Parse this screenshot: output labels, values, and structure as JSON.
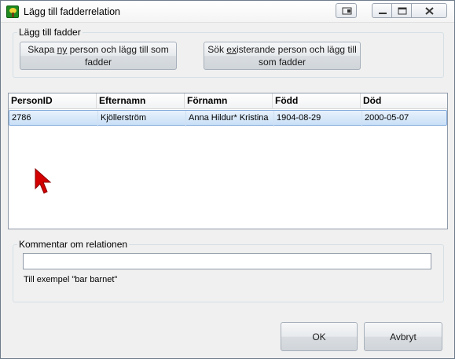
{
  "window": {
    "title": "Lägg till fadderrelation"
  },
  "add_group": {
    "legend": "Lägg till fadder",
    "new_button": {
      "pre": "Skapa ",
      "underlined": "ny",
      "post": " person och lägg till som fadder"
    },
    "search_button": {
      "pre": "Sök ",
      "underlined": "ex",
      "post": "isterande person och lägg till som fadder"
    }
  },
  "table": {
    "columns": [
      "PersonID",
      "Efternamn",
      "Förnamn",
      "Född",
      "Död"
    ],
    "rows": [
      [
        "2786",
        "Kjöllerström",
        "Anna Hildur* Kristina",
        "1904-08-29",
        "2000-05-07"
      ]
    ]
  },
  "comment_group": {
    "legend": "Kommentar om relationen",
    "value": "",
    "hint": "Till exempel \"bar barnet\""
  },
  "buttons": {
    "ok": "OK",
    "cancel": "Avbryt"
  },
  "colors": {
    "selection": "#c9e0f7",
    "cursor": "#d40000"
  }
}
